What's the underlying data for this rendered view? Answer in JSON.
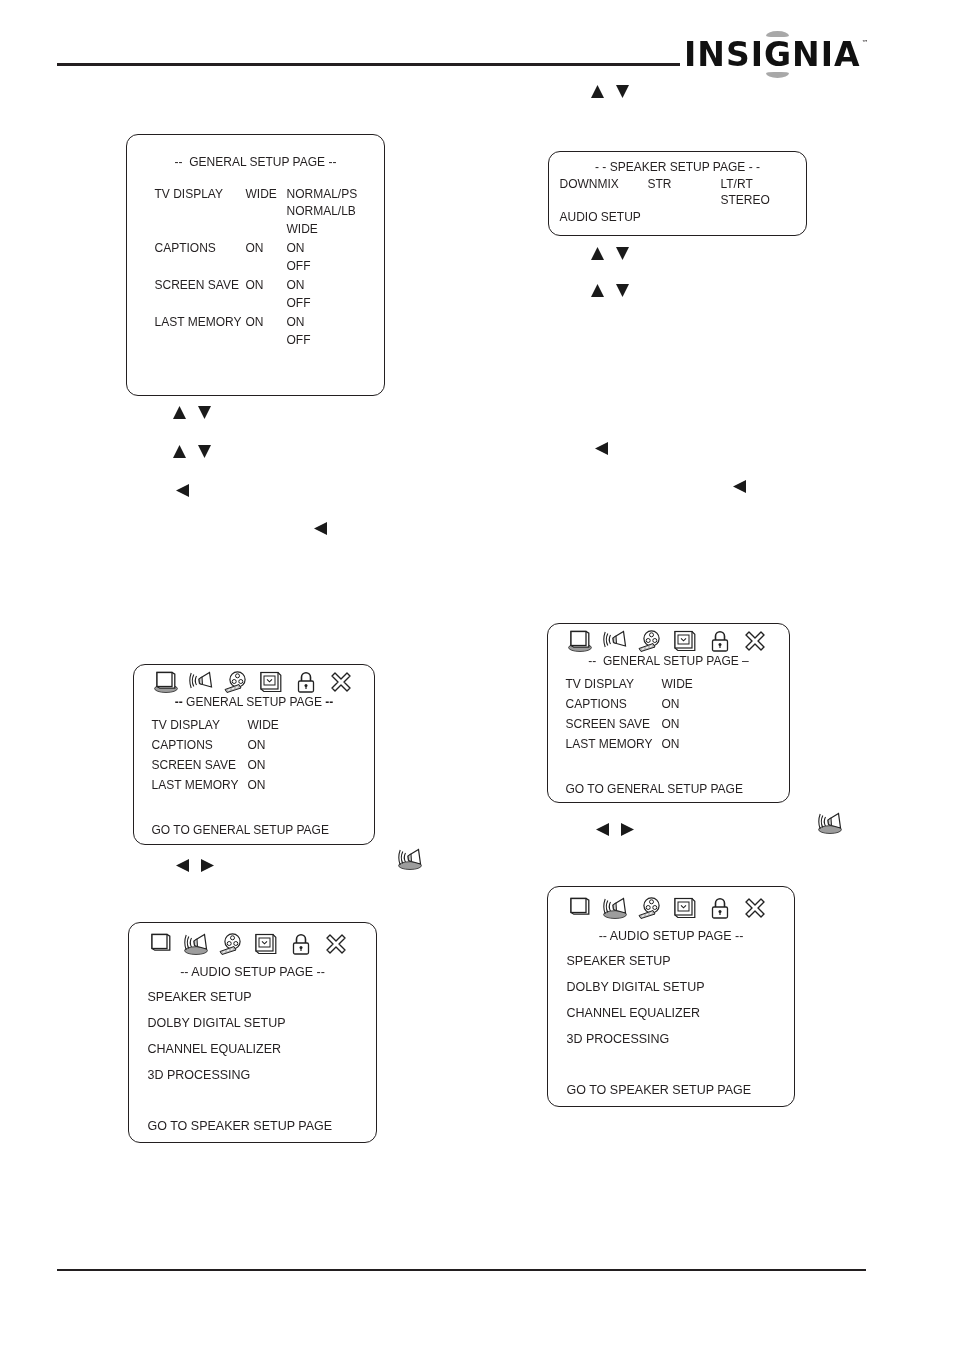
{
  "header": {
    "logo": "INSIGNIA",
    "trademark": "™"
  },
  "left_column": [
    {
      "kind": "panel",
      "title": "--  GENERAL SETUP PAGE --",
      "rows": [
        {
          "label": "TV DISPLAY",
          "value": "WIDE",
          "options": [
            "NORMAL/PS",
            "NORMAL/LB",
            "WIDE"
          ]
        },
        {
          "label": "CAPTIONS",
          "value": "ON",
          "options": [
            "ON",
            "OFF"
          ]
        },
        {
          "label": "SCREEN SAVE",
          "value": "ON",
          "options": [
            "ON",
            "OFF"
          ]
        },
        {
          "label": "LAST MEMORY",
          "value": "ON",
          "options": [
            "ON",
            "OFF"
          ]
        }
      ]
    },
    {
      "kind": "keys",
      "keys": [
        {
          "kind": "up"
        },
        {
          "kind": "down"
        }
      ]
    },
    {
      "kind": "keys",
      "keys": [
        {
          "kind": "up"
        },
        {
          "kind": "down"
        }
      ]
    },
    {
      "kind": "keys",
      "keys": [
        {
          "kind": "left"
        }
      ]
    },
    {
      "kind": "keys",
      "keys": [
        {
          "kind": "left"
        }
      ]
    },
    {
      "kind": "panel",
      "icons": [
        {
          "kind": "tv",
          "selected": true
        },
        {
          "kind": "speaker",
          "selected": false
        },
        {
          "kind": "reel",
          "selected": false
        },
        {
          "kind": "monitor",
          "selected": false
        },
        {
          "kind": "lock",
          "selected": false
        },
        {
          "kind": "close",
          "selected": false
        }
      ],
      "title": "**--** GENERAL SETUP PAGE **--**",
      "rows": [
        {
          "label": "TV DISPLAY",
          "value": "WIDE"
        },
        {
          "label": "CAPTIONS",
          "value": "ON"
        },
        {
          "label": "SCREEN SAVE",
          "value": "ON"
        },
        {
          "label": "LAST MEMORY",
          "value": "ON"
        }
      ],
      "footer": "GO TO GENERAL SETUP PAGE"
    },
    {
      "kind": "keys",
      "keys": [
        {
          "kind": "left"
        },
        {
          "kind": "right"
        },
        {
          "kind": "speaker"
        }
      ]
    },
    {
      "kind": "panel",
      "icons": [
        {
          "kind": "tv",
          "selected": false
        },
        {
          "kind": "speaker",
          "selected": true
        },
        {
          "kind": "reel",
          "selected": false
        },
        {
          "kind": "monitor",
          "selected": false
        },
        {
          "kind": "lock",
          "selected": false
        },
        {
          "kind": "close",
          "selected": false
        }
      ],
      "title": "-- AUDIO SETUP PAGE --",
      "items": [
        "SPEAKER SETUP",
        "DOLBY DIGITAL SETUP",
        "CHANNEL EQUALIZER",
        "3D PROCESSING"
      ],
      "footer": "GO TO SPEAKER SETUP PAGE"
    }
  ],
  "right_column": [
    {
      "kind": "keys",
      "keys": [
        {
          "kind": "up"
        },
        {
          "kind": "down"
        }
      ]
    },
    {
      "kind": "panel",
      "title": "- - SPEAKER SETUP PAGE - -",
      "rows": [
        {
          "label": "DOWNMIX",
          "value": "STR",
          "options": [
            "LT/RT",
            "STEREO"
          ]
        },
        {
          "label": "AUDIO SETUP"
        }
      ]
    },
    {
      "kind": "keys",
      "keys": [
        {
          "kind": "up"
        },
        {
          "kind": "down"
        }
      ]
    },
    {
      "kind": "keys",
      "keys": [
        {
          "kind": "up"
        },
        {
          "kind": "down"
        }
      ]
    },
    {
      "kind": "keys",
      "keys": [
        {
          "kind": "left"
        }
      ]
    },
    {
      "kind": "keys",
      "keys": [
        {
          "kind": "left"
        }
      ]
    },
    {
      "kind": "panel",
      "icons": [
        {
          "kind": "tv",
          "selected": true
        },
        {
          "kind": "speaker",
          "selected": false
        },
        {
          "kind": "reel",
          "selected": false
        },
        {
          "kind": "monitor",
          "selected": false
        },
        {
          "kind": "lock",
          "selected": false
        },
        {
          "kind": "close",
          "selected": false
        }
      ],
      "title": "--  GENERAL SETUP PAGE –",
      "rows": [
        {
          "label": "TV DISPLAY",
          "value": "WIDE"
        },
        {
          "label": "CAPTIONS",
          "value": "ON"
        },
        {
          "label": "SCREEN SAVE",
          "value": "ON"
        },
        {
          "label": "LAST MEMORY",
          "value": "ON"
        }
      ],
      "footer": "GO TO GENERAL SETUP PAGE"
    },
    {
      "kind": "keys",
      "keys": [
        {
          "kind": "left"
        },
        {
          "kind": "right"
        },
        {
          "kind": "speaker"
        }
      ]
    },
    {
      "kind": "panel",
      "icons": [
        {
          "kind": "tv",
          "selected": false
        },
        {
          "kind": "speaker",
          "selected": true
        },
        {
          "kind": "reel",
          "selected": false
        },
        {
          "kind": "monitor",
          "selected": false
        },
        {
          "kind": "lock",
          "selected": false
        },
        {
          "kind": "close",
          "selected": false
        }
      ],
      "title": "-- AUDIO SETUP PAGE --",
      "items": [
        "SPEAKER SETUP",
        "DOLBY DIGITAL SETUP",
        "CHANNEL EQUALIZER",
        "3D PROCESSING"
      ],
      "footer": "GO TO SPEAKER SETUP PAGE"
    }
  ]
}
